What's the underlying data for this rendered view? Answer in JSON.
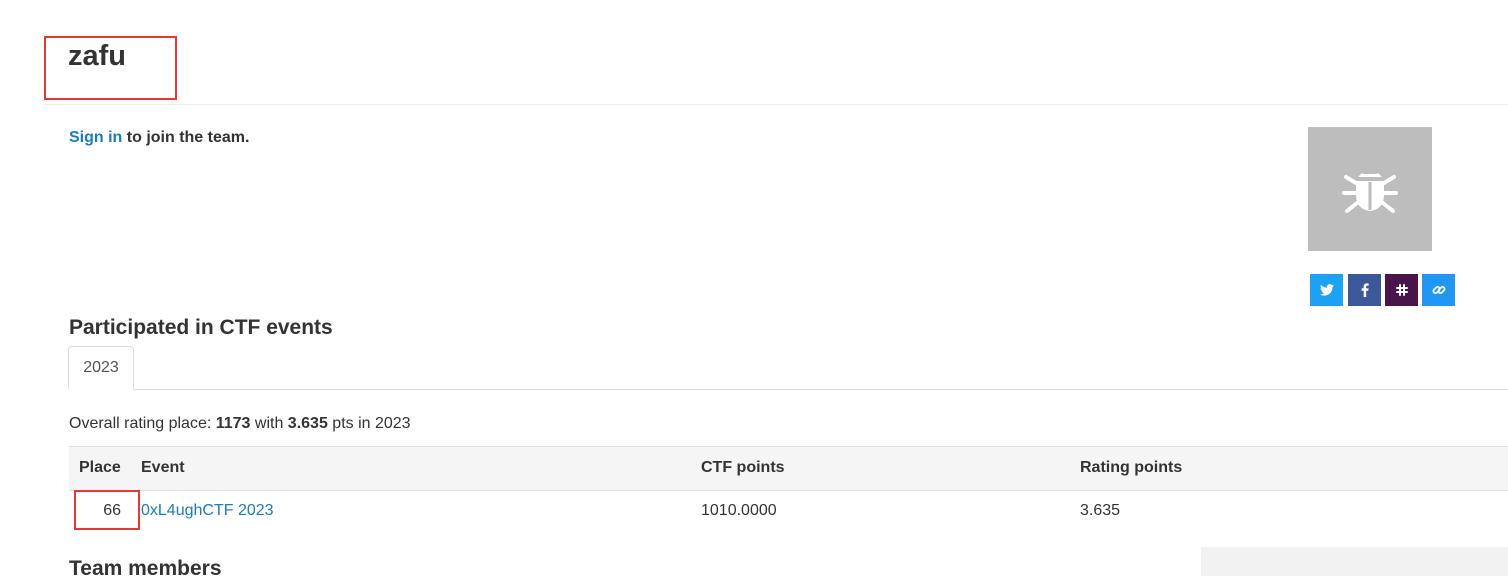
{
  "team": {
    "name": "zafu"
  },
  "signin": {
    "link": "Sign in",
    "rest": " to join the team."
  },
  "share": {
    "twitter": "twitter-icon",
    "facebook": "facebook-icon",
    "slack": "slack-icon",
    "link": "link-icon"
  },
  "events": {
    "title": "Participated in CTF events",
    "tabs": [
      "2023"
    ],
    "summary": {
      "prefix": "Overall rating place: ",
      "place": "1173",
      "mid": " with ",
      "points": "3.635",
      "suffix": " pts in 2023"
    },
    "table": {
      "headers": [
        "Place",
        "Event",
        "CTF points",
        "Rating points"
      ],
      "rows": [
        {
          "place": "66",
          "event": "0xL4ughCTF 2023",
          "ctf_points": "1010.0000",
          "rating_points": "3.635"
        }
      ]
    }
  },
  "members": {
    "title": "Team members"
  },
  "colors": {
    "link": "#1a7bc0",
    "highlight": "#e53935",
    "avatar_bg": "#bdbdbd",
    "twitter": "#1da1f2",
    "facebook": "#3b5998",
    "slack": "#4a154b",
    "share_link": "#2196f3"
  }
}
